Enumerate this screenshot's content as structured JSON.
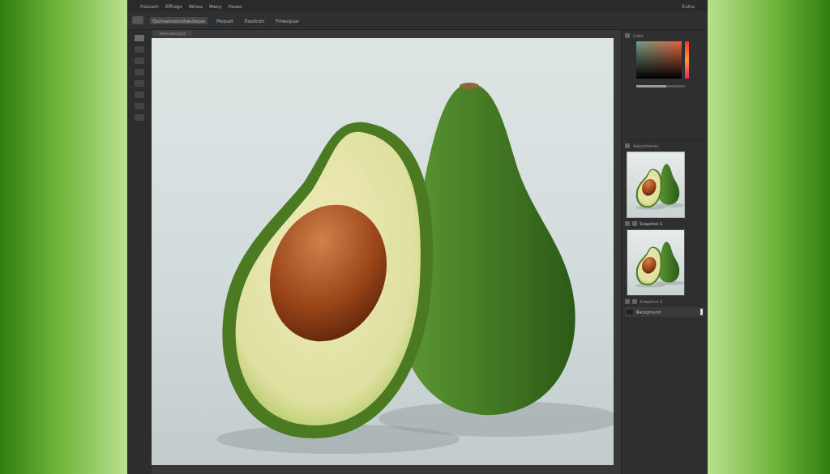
{
  "menu": [
    "Foxsam",
    "Effrogs",
    "Wirea",
    "Mesy",
    "Paxes"
  ],
  "menu_right": "Extra",
  "options": [
    "Quinsensonsheslouse",
    "Poquot",
    "Eoutcon",
    "Finesquar"
  ],
  "document_tab": "Avocado.psd",
  "tools": [
    {
      "selected": true
    },
    {
      "selected": false
    },
    {
      "selected": false
    },
    {
      "selected": false
    },
    {
      "selected": false
    },
    {
      "selected": false
    },
    {
      "selected": false
    },
    {
      "selected": false
    }
  ],
  "color_panel": {
    "label": "Color",
    "level": 0.62
  },
  "history_panel": {
    "label": "Adjustments"
  },
  "snapshots": [
    {
      "label": "Snapshot 1",
      "selected": true
    },
    {
      "label": "Snapshot 2",
      "selected": false
    }
  ],
  "layers": [
    {
      "name": "Background",
      "selected": false
    }
  ]
}
